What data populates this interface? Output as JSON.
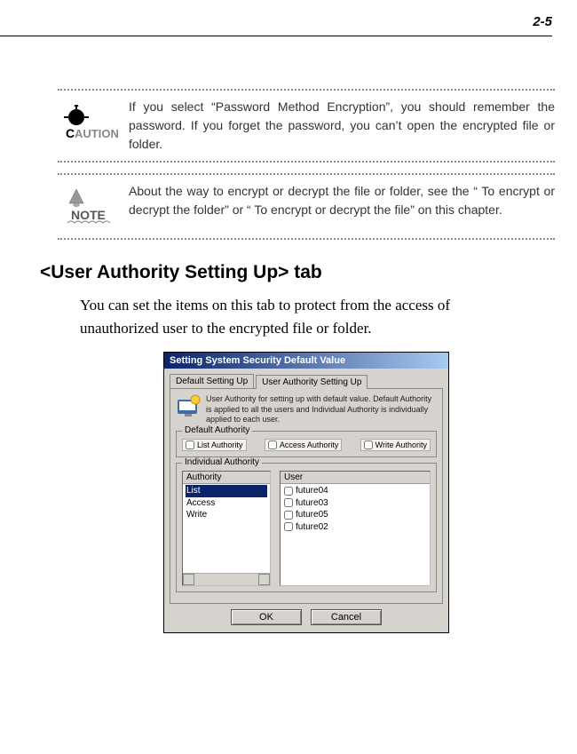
{
  "page_number": "2-5",
  "caution_text": "If you select “Password Method Encryption”, you should remember the password. If you forget the password, you can’t open the encrypted file or folder.",
  "note_text": "About the way to encrypt or decrypt the file or folder, see the “ To encrypt or decrypt the folder” or “ To encrypt or decrypt the file” on this chapter.",
  "heading": "<User Authority Setting Up> tab",
  "body_para": "You can set the items on this tab to protect from the access of unauthorized user to the encrypted file or folder.",
  "dialog": {
    "title": "Setting System Security Default Value",
    "tabs": [
      {
        "label": "Default Setting Up"
      },
      {
        "label": "User Authority Setting Up"
      }
    ],
    "info": "User Authority for setting up with default value. Default Authority is applied to all the users and Individual Authority is individually applied to each user.",
    "default_authority": {
      "legend": "Default Authority",
      "checks": [
        {
          "label": "List Authority"
        },
        {
          "label": "Access Authority"
        },
        {
          "label": "Write Authority"
        }
      ]
    },
    "individual_authority": {
      "legend": "Individual Authority",
      "authority_header": "Authority",
      "authority_items": [
        "List",
        "Access",
        "Write"
      ],
      "user_header": "User",
      "user_items": [
        "future04",
        "future03",
        "future05",
        "future02"
      ]
    },
    "buttons": {
      "ok": "OK",
      "cancel": "Cancel"
    }
  }
}
